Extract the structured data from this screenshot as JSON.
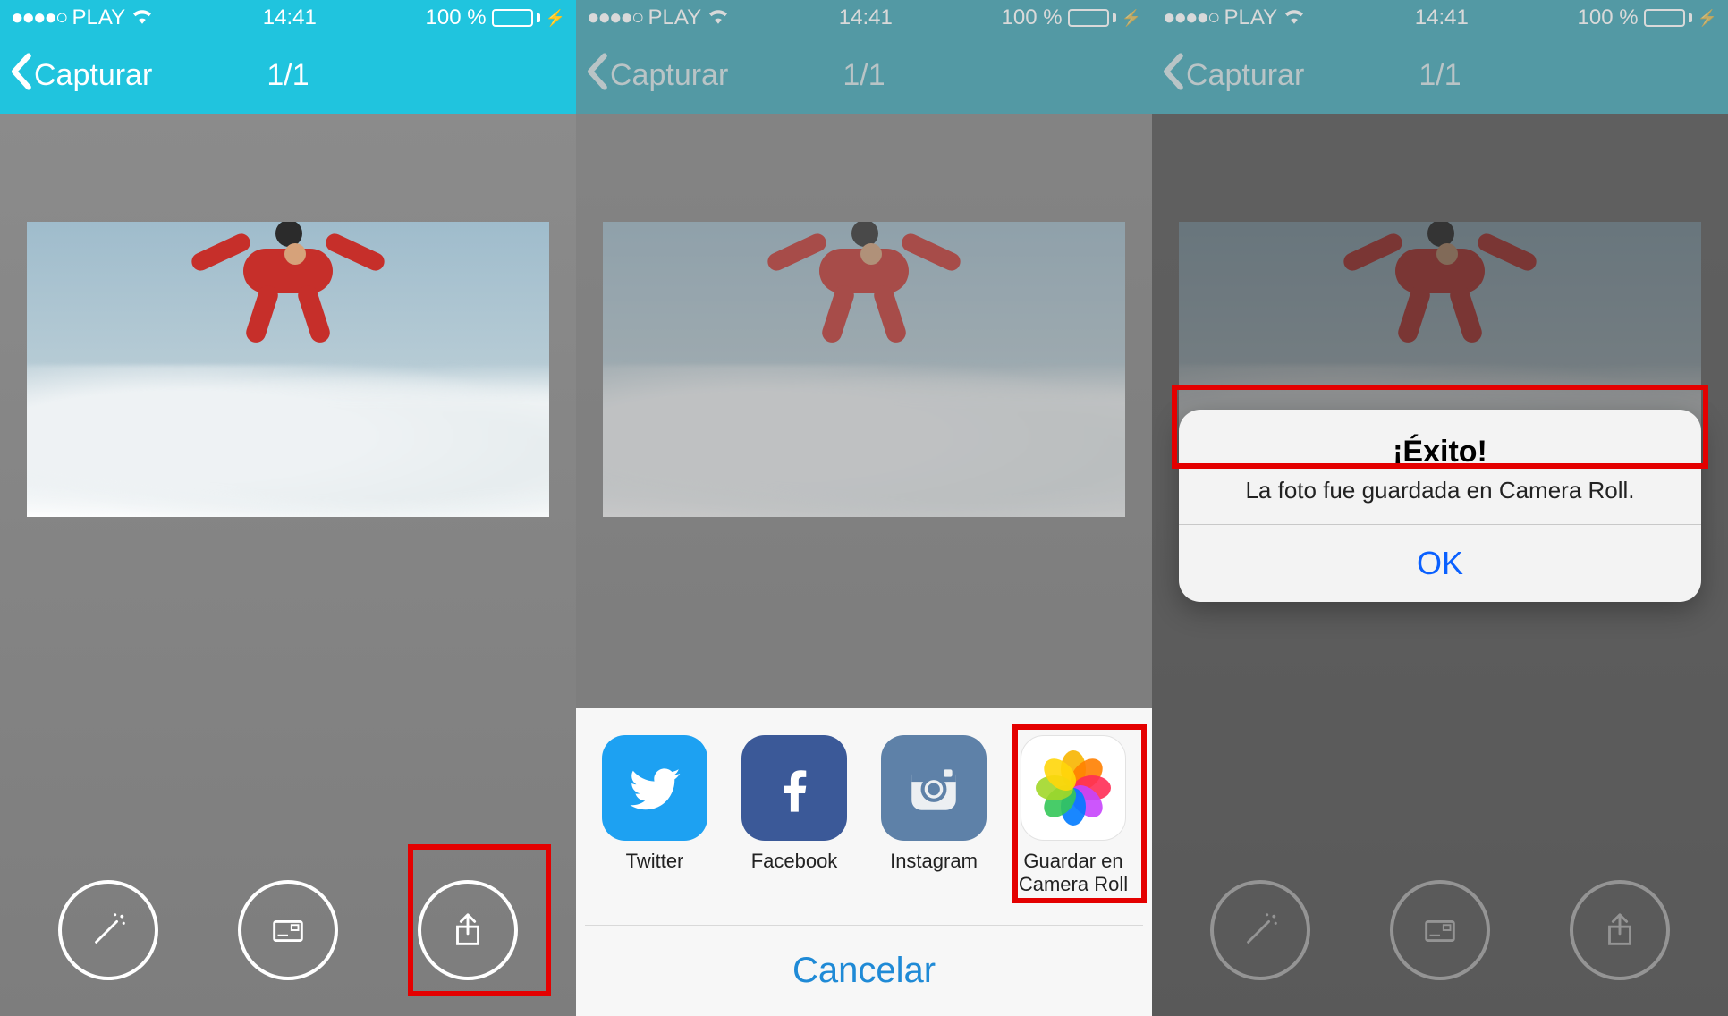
{
  "status_bar": {
    "signal_dots": "●●●●○",
    "carrier": "PLAY",
    "time": "14:41",
    "battery_pct": "100 %"
  },
  "nav": {
    "back_label": "Capturar",
    "title": "1/1"
  },
  "screens": {
    "s1": {
      "highlight_target": "share-button"
    },
    "s2": {
      "share_sheet": {
        "items": [
          {
            "id": "twitter",
            "label": "Twitter"
          },
          {
            "id": "facebook",
            "label": "Facebook"
          },
          {
            "id": "instagram",
            "label": "Instagram"
          },
          {
            "id": "camroll",
            "label": "Guardar en Camera Roll"
          }
        ],
        "cancel": "Cancelar"
      },
      "highlight_target": "share-item-camroll"
    },
    "s3": {
      "alert": {
        "title": "¡Éxito!",
        "message": "La foto fue guardada en Camera Roll.",
        "ok": "OK"
      },
      "highlight_target": "alert-ok-button"
    }
  },
  "share_labels": {
    "twitter": "Twitter",
    "facebook": "Facebook",
    "instagram": "Instagram",
    "camroll": "Guardar en Camera Roll"
  }
}
